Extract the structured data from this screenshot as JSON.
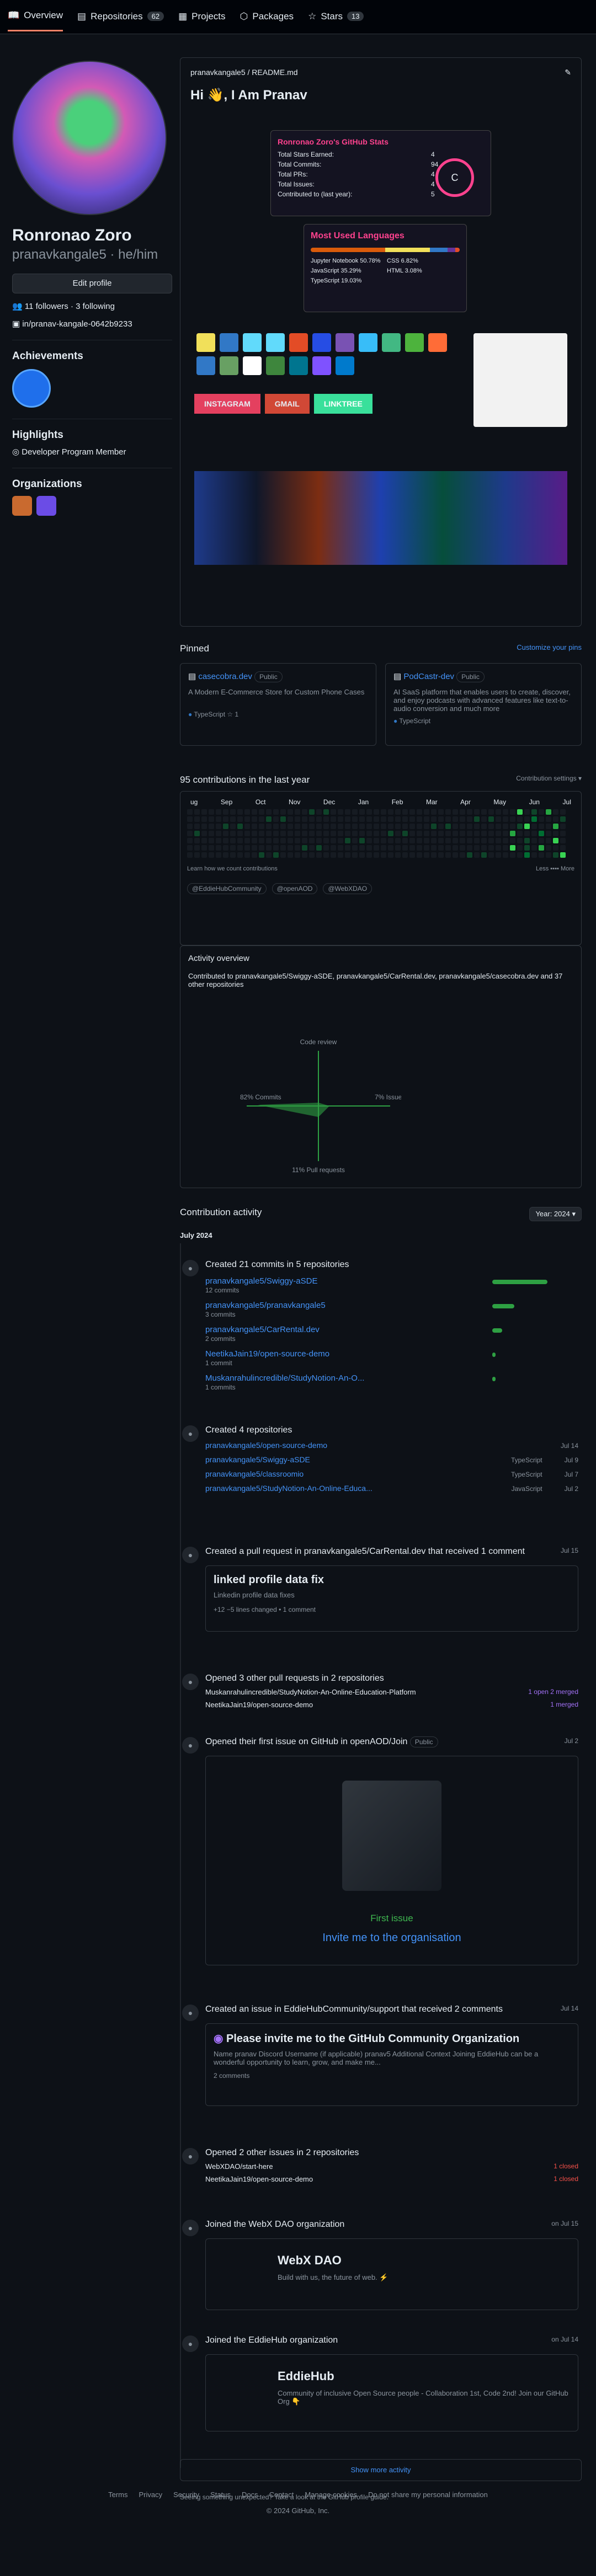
{
  "tabs": [
    {
      "label": "Overview"
    },
    {
      "label": "Repositories",
      "count": "62"
    },
    {
      "label": "Projects"
    },
    {
      "label": "Packages"
    },
    {
      "label": "Stars",
      "count": "13"
    }
  ],
  "profile": {
    "name": "Ronronao Zoro",
    "handle": "pranavkangale5 · he/him",
    "edit": "Edit profile",
    "followers": "11 followers · 3 following",
    "linkedin": "in/pranav-kangale-0642b9233",
    "achievements": "Achievements",
    "highlights": "Highlights",
    "highlight_item": "Developer Program Member",
    "orgs": "Organizations"
  },
  "readme": {
    "path": "pranavkangale5 / README.md",
    "heading": "Hi 👋, I Am Pranav",
    "stats_title": "Ronronao Zoro's GitHub Stats",
    "stats": [
      {
        "label": "Total Stars Earned:",
        "value": "4"
      },
      {
        "label": "Total Commits:",
        "value": "94"
      },
      {
        "label": "Total PRs:",
        "value": "4"
      },
      {
        "label": "Total Issues:",
        "value": "4"
      },
      {
        "label": "Contributed to (last year):",
        "value": "5"
      }
    ],
    "grade": "C",
    "lang_title": "Most Used Languages",
    "langs": [
      "Jupyter Notebook 50.78%",
      "CSS 6.82%",
      "JavaScript 35.29%",
      "HTML 3.08%",
      "TypeScript 19.03%"
    ],
    "buttons": [
      "INSTAGRAM",
      "GMAIL",
      "LINKTREE"
    ]
  },
  "pinned": {
    "title": "Pinned",
    "customize": "Customize your pins",
    "repos": [
      {
        "name": "casecobra.dev",
        "badge": "Public",
        "desc": "A Modern E-Commerce Store for Custom Phone Cases",
        "lang": "TypeScript",
        "stars": "1"
      },
      {
        "name": "PodCastr-dev",
        "badge": "Public",
        "desc": "AI SaaS platform that enables users to create, discover, and enjoy podcasts with advanced features like text-to-audio conversion and much more",
        "lang": "TypeScript"
      }
    ]
  },
  "contrib": {
    "title": "95 contributions in the last year",
    "settings": "Contribution settings ▾",
    "months": [
      "ug",
      "Sep",
      "Oct",
      "Nov",
      "Dec",
      "Jan",
      "Feb",
      "Mar",
      "Apr",
      "May",
      "Jun",
      "Jul"
    ],
    "learn": "Learn how we count contributions",
    "less": "Less",
    "more": "More",
    "orgs": [
      "@EddieHubCommunity",
      "@openAOD",
      "@WebXDAO"
    ],
    "overview": "Activity overview",
    "contributed": "Contributed to pranavkangale5/Swiggy-aSDE, pranavkangale5/CarRental.dev, pranavkangale5/casecobra.dev and 37 other repositories",
    "code_review": "Code review",
    "commits": "82%\nCommits",
    "issues": "7%\nIssues",
    "prs": "11%\nPull requests"
  },
  "activity": {
    "title": "Contribution activity",
    "year": "Year: 2024 ▾",
    "month": "July 2024",
    "commits_h": "Created 21 commits in 5 repositories",
    "commits": [
      {
        "repo": "pranavkangale5/Swiggy-aSDE",
        "n": "12 commits",
        "w": 100
      },
      {
        "repo": "pranavkangale5/pranavkangale5",
        "n": "3 commits",
        "w": 40
      },
      {
        "repo": "pranavkangale5/CarRental.dev",
        "n": "2 commits",
        "w": 18
      },
      {
        "repo": "NeetikaJain19/open-source-demo",
        "n": "1 commit",
        "w": 6
      },
      {
        "repo": "Muskanrahulincredible/StudyNotion-An-O...",
        "n": "1 commits",
        "w": 6
      }
    ],
    "repos_h": "Created 4 repositories",
    "repos": [
      {
        "n": "pranavkangale5/open-source-demo",
        "lang": "",
        "d": "Jul 14"
      },
      {
        "n": "pranavkangale5/Swiggy-aSDE",
        "lang": "TypeScript",
        "d": "Jul 9"
      },
      {
        "n": "pranavkangale5/classroomio",
        "lang": "TypeScript",
        "d": "Jul 7"
      },
      {
        "n": "pranavkangale5/StudyNotion-An-Online-Educa...",
        "lang": "JavaScript",
        "d": "Jul 2"
      }
    ],
    "pr_h": "Created a pull request in pranavkangale5/CarRental.dev that received 1 comment",
    "pr_date": "Jul 15",
    "pr_title": "linked profile data fix",
    "pr_sub": "Linkedin profile data fixes",
    "pr_stat": "+12 −5 lines changed • 1 comment",
    "otherpr_h": "Opened 3 other pull requests in 2 repositories",
    "otherpr": [
      {
        "r": "Muskanrahulincredible/StudyNotion-An-Online-Education-Platform",
        "s": "1 open  2 merged"
      },
      {
        "r": "NeetikaJain19/open-source-demo",
        "s": "1 merged"
      }
    ],
    "issue1_h": "Opened their first issue on GitHub in openAOD/Join",
    "issue1_badge": "Public",
    "issue1_date": "Jul 2",
    "first_issue": "First issue",
    "invite": "Invite me to the organisation",
    "issue2_h": "Created an issue in EddieHubCommunity/support that received 2 comments",
    "issue2_date": "Jul 14",
    "issue2_title": "Please invite me to the GitHub Community Organization",
    "issue2_body": "Name pranav Discord Username (if applicable) pranav5 Additional Context Joining EddieHub can be a wonderful opportunity to learn, grow, and make me...",
    "issue2_comments": "2 comments",
    "other_issues_h": "Opened 2 other issues in 2 repositories",
    "other_issues": [
      {
        "r": "WebXDAO/start-here",
        "s": "1 closed"
      },
      {
        "r": "NeetikaJain19/open-source-demo",
        "s": "1 closed"
      }
    ],
    "webx_h": "Joined the WebX DAO organization",
    "webx_date": "on Jul 15",
    "webx_name": "WebX DAO",
    "webx_desc": "Build with us, the future of web. ⚡",
    "eddie_h": "Joined the EddieHub organization",
    "eddie_date": "on Jul 14",
    "eddie_name": "EddieHub",
    "eddie_desc": "Community of inclusive Open Source people - Collaboration 1st, Code 2nd! Join our GitHub Org 👇",
    "show_more": "Show more activity",
    "unexpected": "Seeing something unexpected? Take a look at the GitHub profile guide."
  },
  "footer": {
    "links": [
      "Terms",
      "Privacy",
      "Security",
      "Status",
      "Docs",
      "Contact",
      "Manage cookies",
      "Do not share my personal information"
    ],
    "copy": "© 2024 GitHub, Inc."
  },
  "colors": {
    "accent": "#4493f8",
    "green": "#2ea043",
    "bg": "#0d1117"
  }
}
